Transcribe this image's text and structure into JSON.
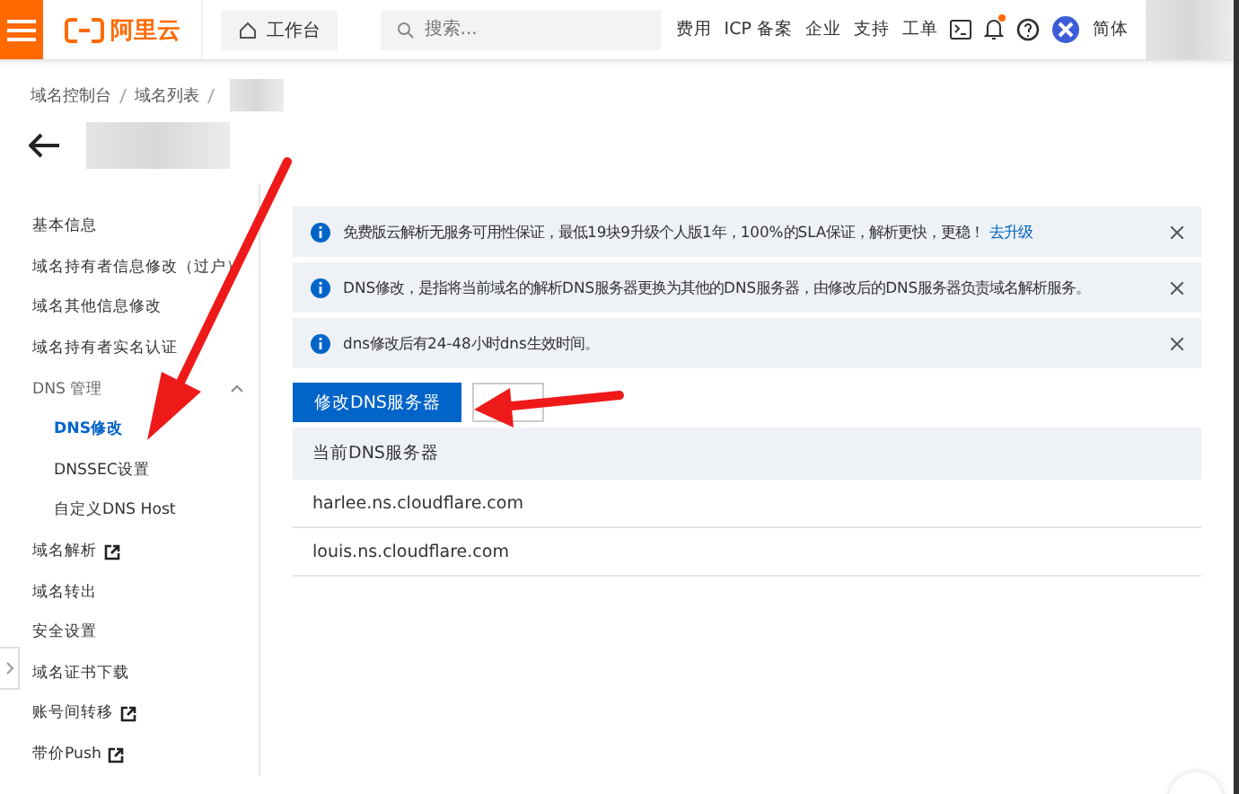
{
  "topbar": {
    "logo": "阿里云",
    "workbench": "工作台",
    "search": {
      "placeholder": "搜索..."
    },
    "links": [
      "费用",
      "ICP 备案",
      "企业",
      "支持",
      "工单"
    ],
    "notification_dot": true,
    "language": "简体"
  },
  "breadcrumb": [
    "域名控制台",
    "域名列表"
  ],
  "sidebar": {
    "items": [
      {
        "label": "基本信息",
        "kind": "item",
        "external": false
      },
      {
        "label": "域名持有者信息修改（过户）",
        "kind": "item",
        "external": false
      },
      {
        "label": "域名其他信息修改",
        "kind": "item",
        "external": false
      },
      {
        "label": "域名持有者实名认证",
        "kind": "item",
        "external": false
      },
      {
        "label": "DNS 管理",
        "kind": "group",
        "expanded": true,
        "children": [
          {
            "label": "DNS修改",
            "selected": true
          },
          {
            "label": "DNSSEC设置",
            "selected": false
          },
          {
            "label": "自定义DNS Host",
            "selected": false
          }
        ]
      },
      {
        "label": "域名解析",
        "kind": "item",
        "external": true
      },
      {
        "label": "域名转出",
        "kind": "item",
        "external": false
      },
      {
        "label": "安全设置",
        "kind": "item",
        "external": false
      },
      {
        "label": "域名证书下载",
        "kind": "item",
        "external": false
      },
      {
        "label": "账号间转移",
        "kind": "item",
        "external": true
      },
      {
        "label": "带价Push",
        "kind": "item",
        "external": true
      }
    ]
  },
  "notices": [
    {
      "text": "免费版云解析无服务可用性保证，最低19块9升级个人版1年，100%的SLA保证，解析更快，更稳！",
      "link": "去升级"
    },
    {
      "text": "DNS修改，是指将当前域名的解析DNS服务器更换为其他的DNS服务器，由修改后的DNS服务器负责域名解析服务。"
    },
    {
      "text": "dns修改后有24-48小时dns生效时间。"
    }
  ],
  "primary_button": "修改DNS服务器",
  "table": {
    "columns": [
      "当前DNS服务器"
    ],
    "rows": [
      [
        "harlee.ns.cloudflare.com"
      ],
      [
        "louis.ns.cloudflare.com"
      ]
    ]
  }
}
